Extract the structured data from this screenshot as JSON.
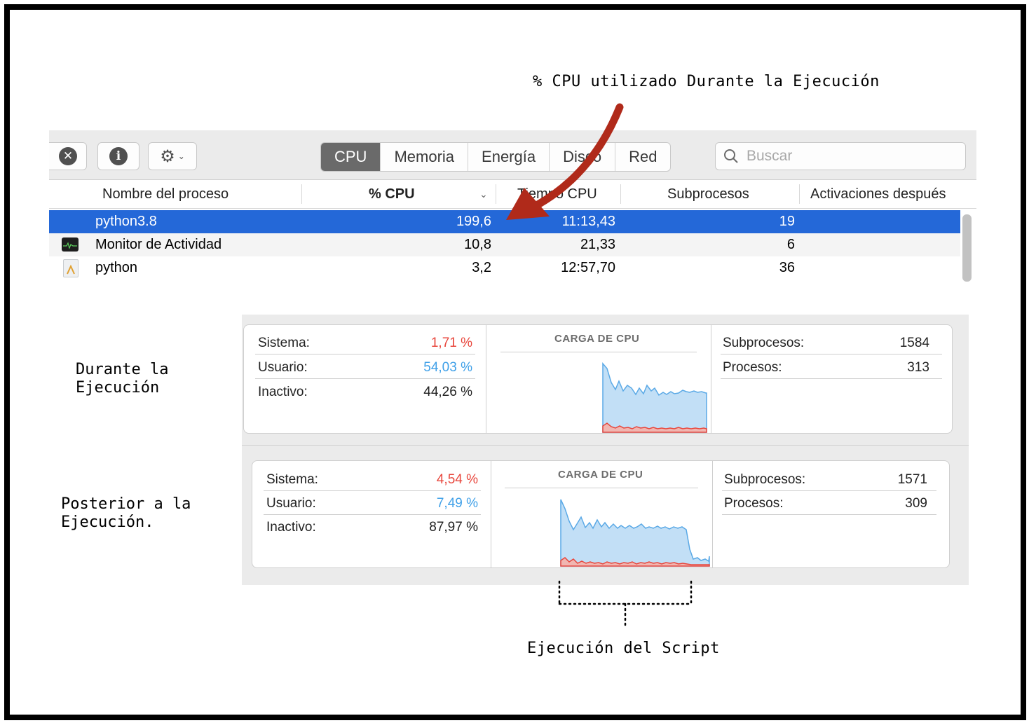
{
  "annotations": {
    "top": "% CPU utilizado Durante la Ejecución",
    "during": "Durante la\nEjecución",
    "after": "Posterior a la\nEjecución.",
    "bottom": "Ejecución del Script"
  },
  "toolbar": {
    "tabs": [
      "CPU",
      "Memoria",
      "Energía",
      "Disco",
      "Red"
    ],
    "active_tab": "CPU",
    "search_placeholder": "Buscar"
  },
  "table": {
    "columns": [
      "Nombre del proceso",
      "% CPU",
      "Tiempo CPU",
      "Subprocesos",
      "Activaciones después"
    ],
    "rows": [
      {
        "name": "python3.8",
        "cpu": "199,6",
        "time": "11:13,43",
        "threads": "19"
      },
      {
        "name": "Monitor de Actividad",
        "cpu": "10,8",
        "time": "21,33",
        "threads": "6"
      },
      {
        "name": "python",
        "cpu": "3,2",
        "time": "12:57,70",
        "threads": "36"
      }
    ]
  },
  "panels": [
    {
      "sistema_label": "Sistema:",
      "sistema": "1,71 %",
      "usuario_label": "Usuario:",
      "usuario": "54,03 %",
      "inactivo_label": "Inactivo:",
      "inactivo": "44,26 %",
      "chart_title": "CARGA DE CPU",
      "subprocesos_label": "Subprocesos:",
      "subprocesos": "1584",
      "procesos_label": "Procesos:",
      "procesos": "313"
    },
    {
      "sistema_label": "Sistema:",
      "sistema": "4,54 %",
      "usuario_label": "Usuario:",
      "usuario": "7,49 %",
      "inactivo_label": "Inactivo:",
      "inactivo": "87,97 %",
      "chart_title": "CARGA DE CPU",
      "subprocesos_label": "Subprocesos:",
      "subprocesos": "1571",
      "procesos_label": "Procesos:",
      "procesos": "309"
    }
  ],
  "colors": {
    "sistema": "#e8463c",
    "usuario": "#3fa0e8",
    "selection": "#2468d8",
    "arrow": "#b02a1a"
  }
}
